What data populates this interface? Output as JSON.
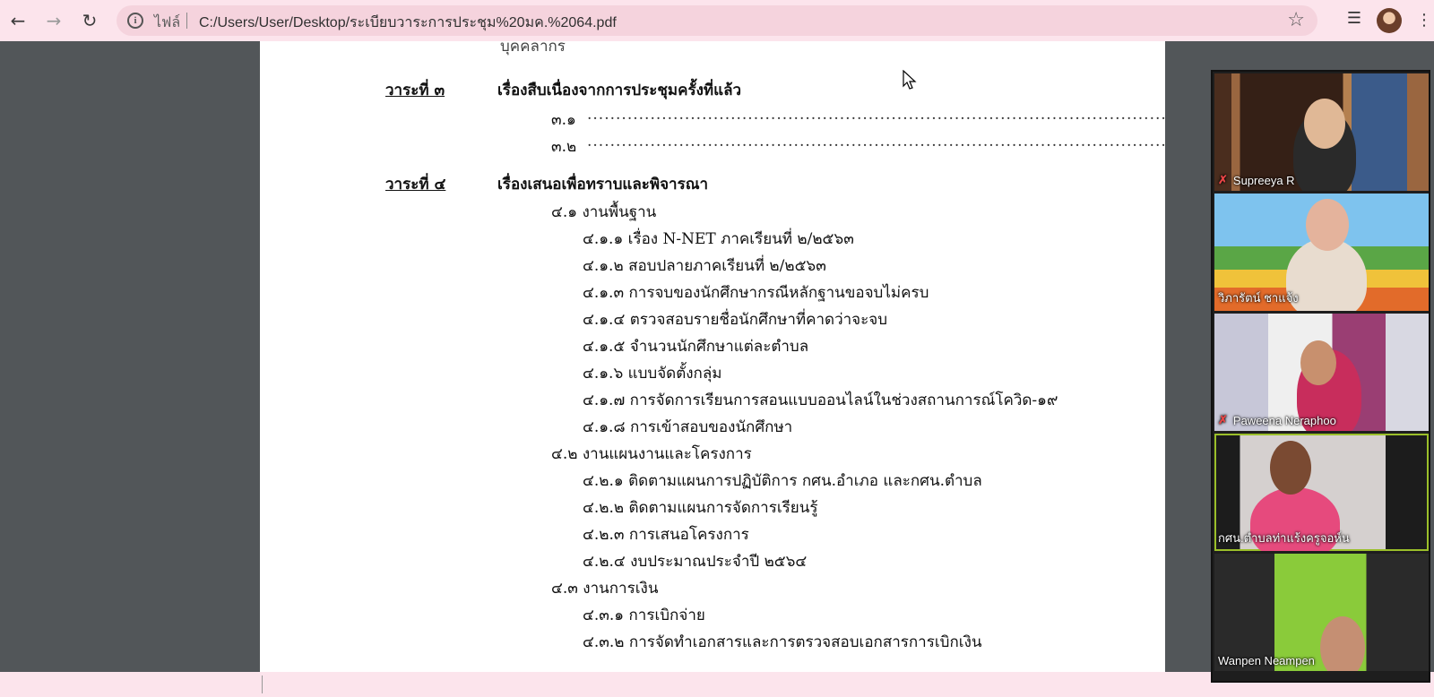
{
  "browser": {
    "scheme_label": "ไฟล์",
    "url": "C:/Users/User/Desktop/ระเบียบวาระการประชุม%20มค.%2064.pdf",
    "icons": {
      "back": "arrow-left-icon",
      "forward": "arrow-right-icon",
      "reload": "reload-icon",
      "info": "info-icon",
      "bookmark": "star-icon",
      "media": "media-queue-icon",
      "menu": "kebab-menu-icon"
    }
  },
  "document": {
    "cut_text": "บุคคลากร",
    "agenda3": {
      "label": "วาระที่ ๓",
      "title": "เรื่องสืบเนื่องจากการประชุมครั้งที่แล้ว",
      "items": [
        "๓.๑",
        "๓.๒"
      ]
    },
    "agenda4": {
      "label": "วาระที่ ๔",
      "title": "เรื่องเสนอเพื่อทราบและพิจารณา"
    },
    "lines": [
      {
        "level": 1,
        "text": "๔.๑ งานพื้นฐาน"
      },
      {
        "level": 2,
        "text": "๔.๑.๑ เรื่อง N-NET ภาคเรียนที่ ๒/๒๕๖๓"
      },
      {
        "level": 2,
        "text": "๔.๑.๒ สอบปลายภาคเรียนที่ ๒/๒๕๖๓"
      },
      {
        "level": 2,
        "text": "๔.๑.๓ การจบของนักศึกษากรณีหลักฐานขอจบไม่ครบ"
      },
      {
        "level": 2,
        "text": "๔.๑.๔ ตรวจสอบรายชื่อนักศึกษาที่คาดว่าจะจบ"
      },
      {
        "level": 2,
        "text": "๔.๑.๕ จำนวนนักศึกษาแต่ละตำบล"
      },
      {
        "level": 2,
        "text": "๔.๑.๖ แบบจัดตั้งกลุ่ม"
      },
      {
        "level": 2,
        "text": "๔.๑.๗ การจัดการเรียนการสอนแบบออนไลน์ในช่วงสถานการณ์โควิด-๑๙"
      },
      {
        "level": 2,
        "text": "๔.๑.๘ การเข้าสอบของนักศึกษา"
      },
      {
        "level": 1,
        "text": "๔.๒ งานแผนงานและโครงการ"
      },
      {
        "level": 2,
        "text": "๔.๒.๑ ติดตามแผนการปฏิบัติการ กศน.อำเภอ และกศน.ตำบล"
      },
      {
        "level": 2,
        "text": "๔.๒.๒ ติดตามแผนการจัดการเรียนรู้"
      },
      {
        "level": 2,
        "text": "๔.๒.๓ การเสนอโครงการ"
      },
      {
        "level": 2,
        "text": "๔.๒.๔ งบประมาณประจำปี ๒๕๖๔"
      },
      {
        "level": 1,
        "text": "๔.๓ งานการเงิน"
      },
      {
        "level": 2,
        "text": "๔.๓.๑ การเบิกจ่าย"
      },
      {
        "level": 2,
        "text": "๔.๓.๒ การจัดทำเอกสารและการตรวจสอบเอกสารการเบิกเงิน"
      }
    ]
  },
  "participants": [
    {
      "name": "Supreeya R",
      "muted": true,
      "active": false
    },
    {
      "name": "วิภารัตน์ ชาแจ้ง",
      "muted": false,
      "active": false
    },
    {
      "name": "Paweena Neraphoo",
      "muted": true,
      "active": false
    },
    {
      "name": "กศน.ตำบลท่าแร้งครูจอห์น",
      "muted": false,
      "active": true
    },
    {
      "name": "Wanpen Neampen",
      "muted": false,
      "active": false
    }
  ]
}
